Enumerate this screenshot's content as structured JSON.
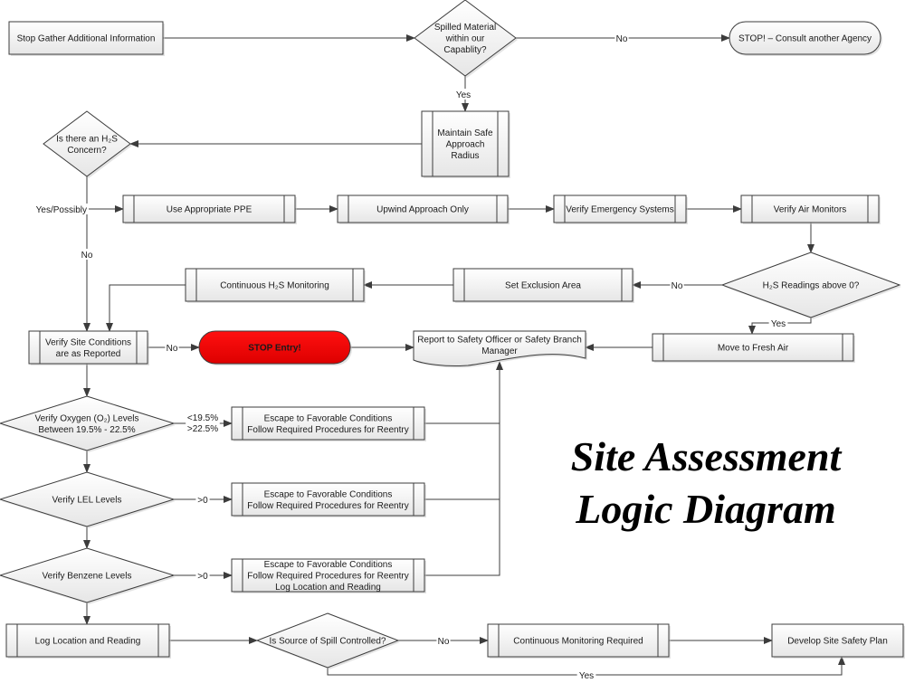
{
  "title": {
    "line1": "Site Assessment",
    "line2": "Logic Diagram"
  },
  "colors": {
    "node_fill_top": "#ffffff",
    "node_fill_bottom": "#e8e8e8",
    "stroke": "#3c3c3c",
    "stop_fill": "#ee0000",
    "shadow": "#c8c8c8"
  },
  "nodes": {
    "gather_info": {
      "type": "process",
      "lines": [
        "Stop Gather Additional Information"
      ]
    },
    "capability": {
      "type": "decision",
      "lines": [
        "Spilled Material",
        "within our",
        "Capablity?"
      ]
    },
    "consult_agency": {
      "type": "terminator",
      "lines": [
        "STOP! – Consult another Agency"
      ]
    },
    "safe_radius": {
      "type": "predefined",
      "lines": [
        "Maintain Safe",
        "Approach",
        "Radius"
      ]
    },
    "h2s_concern": {
      "type": "decision",
      "lines": [
        "Is there an H₂S",
        "Concern?"
      ]
    },
    "ppe": {
      "type": "predefined",
      "lines": [
        "Use Appropriate PPE"
      ]
    },
    "upwind": {
      "type": "predefined",
      "lines": [
        "Upwind Approach Only"
      ]
    },
    "emergency_systems": {
      "type": "predefined",
      "lines": [
        "Verify Emergency Systems"
      ]
    },
    "air_monitors": {
      "type": "predefined",
      "lines": [
        "Verify Air Monitors"
      ]
    },
    "h2s_readings": {
      "type": "decision",
      "lines": [
        "H₂S Readings above 0?"
      ]
    },
    "exclusion_area": {
      "type": "predefined",
      "lines": [
        "Set Exclusion Area"
      ]
    },
    "h2s_monitoring": {
      "type": "predefined",
      "lines": [
        "Continuous H₂S Monitoring"
      ]
    },
    "site_conditions": {
      "type": "predefined",
      "lines": [
        "Verify Site Conditions",
        "are as Reported"
      ]
    },
    "stop_entry": {
      "type": "terminator",
      "lines": [
        "STOP Entry!"
      ]
    },
    "report_safety": {
      "type": "document",
      "lines": [
        "Report to Safety Officer or Safety Branch",
        "Manager"
      ]
    },
    "fresh_air": {
      "type": "predefined",
      "lines": [
        "Move to Fresh Air"
      ]
    },
    "oxygen": {
      "type": "decision",
      "lines": [
        "Verify Oxygen (O₂) Levels",
        "Between 19.5% - 22.5%"
      ]
    },
    "escape_oxygen": {
      "type": "predefined",
      "lines": [
        "Escape to Favorable Conditions",
        "Follow Required Procedures for Reentry"
      ]
    },
    "lel": {
      "type": "decision",
      "lines": [
        "Verify LEL Levels"
      ]
    },
    "escape_lel": {
      "type": "predefined",
      "lines": [
        "Escape to Favorable Conditions",
        "Follow Required Procedures for Reentry"
      ]
    },
    "benzene": {
      "type": "decision",
      "lines": [
        "Verify Benzene Levels"
      ]
    },
    "escape_benzene": {
      "type": "predefined",
      "lines": [
        "Escape to Favorable Conditions",
        "Follow Required Procedures for Reentry",
        "Log Location and Reading"
      ]
    },
    "log_location": {
      "type": "predefined",
      "lines": [
        "Log Location and Reading"
      ]
    },
    "spill_controlled": {
      "type": "decision",
      "lines": [
        "Is Source of Spill Controlled?"
      ]
    },
    "continuous_monitoring": {
      "type": "predefined",
      "lines": [
        "Continuous Monitoring Required"
      ]
    },
    "safety_plan": {
      "type": "process",
      "lines": [
        "Develop Site Safety Plan"
      ]
    }
  },
  "edges": [
    {
      "from": "gather_info",
      "to": "capability",
      "label": ""
    },
    {
      "from": "capability",
      "to": "consult_agency",
      "label": "No"
    },
    {
      "from": "capability",
      "to": "safe_radius",
      "label": "Yes"
    },
    {
      "from": "safe_radius",
      "to": "h2s_concern",
      "label": ""
    },
    {
      "from": "h2s_concern",
      "to": "ppe",
      "label": "Yes/Possibly"
    },
    {
      "from": "h2s_concern",
      "to": "site_conditions",
      "label": "No"
    },
    {
      "from": "ppe",
      "to": "upwind",
      "label": ""
    },
    {
      "from": "upwind",
      "to": "emergency_systems",
      "label": ""
    },
    {
      "from": "emergency_systems",
      "to": "air_monitors",
      "label": ""
    },
    {
      "from": "air_monitors",
      "to": "h2s_readings",
      "label": ""
    },
    {
      "from": "h2s_readings",
      "to": "exclusion_area",
      "label": "No"
    },
    {
      "from": "h2s_readings",
      "to": "fresh_air",
      "label": "Yes"
    },
    {
      "from": "exclusion_area",
      "to": "h2s_monitoring",
      "label": ""
    },
    {
      "from": "h2s_monitoring",
      "to": "site_conditions",
      "label": ""
    },
    {
      "from": "site_conditions",
      "to": "stop_entry",
      "label": "No"
    },
    {
      "from": "stop_entry",
      "to": "report_safety",
      "label": ""
    },
    {
      "from": "fresh_air",
      "to": "report_safety",
      "label": ""
    },
    {
      "from": "site_conditions",
      "to": "oxygen",
      "label": ""
    },
    {
      "from": "oxygen",
      "to": "escape_oxygen",
      "label": "<19.5%\n>22.5%"
    },
    {
      "from": "oxygen",
      "to": "lel",
      "label": ""
    },
    {
      "from": "lel",
      "to": "escape_lel",
      "label": ">0"
    },
    {
      "from": "lel",
      "to": "benzene",
      "label": ""
    },
    {
      "from": "benzene",
      "to": "escape_benzene",
      "label": ">0"
    },
    {
      "from": "benzene",
      "to": "log_location",
      "label": ""
    },
    {
      "from": "escape_oxygen",
      "to": "report_safety",
      "label": ""
    },
    {
      "from": "escape_lel",
      "to": "report_safety",
      "label": ""
    },
    {
      "from": "escape_benzene",
      "to": "report_safety",
      "label": ""
    },
    {
      "from": "log_location",
      "to": "spill_controlled",
      "label": ""
    },
    {
      "from": "spill_controlled",
      "to": "continuous_monitoring",
      "label": "No"
    },
    {
      "from": "spill_controlled",
      "to": "safety_plan",
      "label": "Yes"
    },
    {
      "from": "continuous_monitoring",
      "to": "safety_plan",
      "label": ""
    }
  ]
}
